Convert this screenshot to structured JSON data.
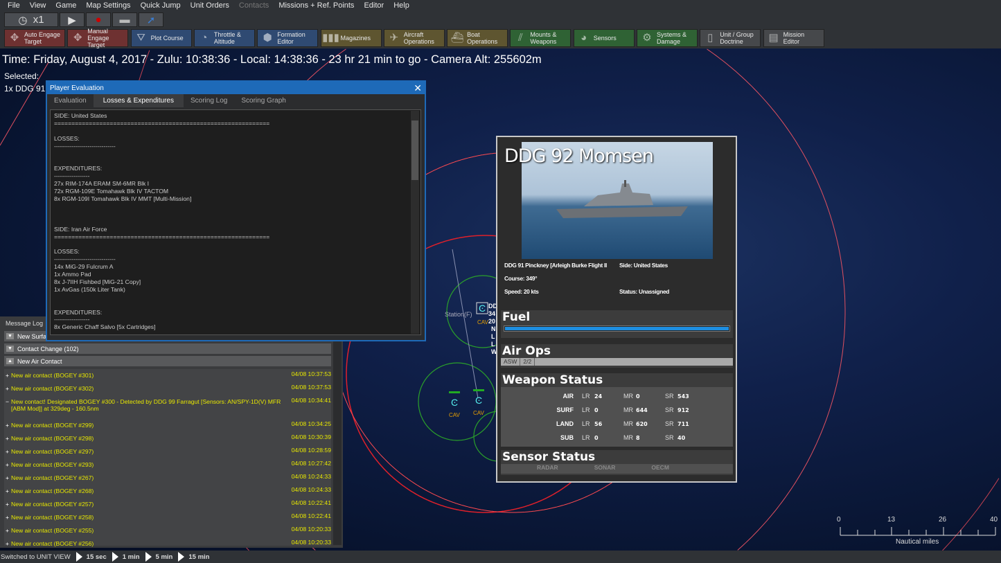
{
  "menu": [
    "File",
    "View",
    "Game",
    "Map Settings",
    "Quick Jump",
    "Unit Orders",
    "Contacts",
    "Missions + Ref. Points",
    "Editor",
    "Help"
  ],
  "menu_disabled": [
    "Contacts"
  ],
  "time_controls": {
    "speed": "x1",
    "icons": [
      "clock-icon",
      "play-icon",
      "record-icon",
      "layers-icon",
      "jump-arrow-icon"
    ]
  },
  "toolbar": [
    {
      "label1": "Auto Engage",
      "label2": "Target",
      "color": "red",
      "icon": "crosshair-icon"
    },
    {
      "label1": "Manual",
      "label2": "Engage Target",
      "color": "red",
      "icon": "crosshair-icon"
    },
    {
      "label1": "Plot Course",
      "label2": "",
      "color": "blue",
      "icon": "course-icon"
    },
    {
      "label1": "Throttle &",
      "label2": "Altitude",
      "color": "blue",
      "icon": "gauge-icon"
    },
    {
      "label1": "Formation",
      "label2": "Editor",
      "color": "blue",
      "icon": "formation-icon"
    },
    {
      "label1": "Magazines",
      "label2": "",
      "color": "olive",
      "icon": "ammo-icon"
    },
    {
      "label1": "Aircraft",
      "label2": "Operations",
      "color": "olive",
      "icon": "aircraft-icon"
    },
    {
      "label1": "Boat",
      "label2": "Operations",
      "color": "olive",
      "icon": "boat-icon"
    },
    {
      "label1": "Mounts &",
      "label2": "Weapons",
      "color": "green",
      "icon": "weapons-icon"
    },
    {
      "label1": "Sensors",
      "label2": "",
      "color": "green",
      "icon": "radar-icon"
    },
    {
      "label1": "Systems &",
      "label2": "Damage",
      "color": "green",
      "icon": "gear-icon"
    },
    {
      "label1": "Unit / Group",
      "label2": "Doctrine",
      "color": "gray",
      "icon": "document-icon"
    },
    {
      "label1": "Mission",
      "label2": "Editor",
      "color": "gray",
      "icon": "mission-icon"
    }
  ],
  "time_line": "Time: Friday, August 4, 2017 - Zulu: 10:38:36 - Local: 14:38:36 - 23 hr 21 min to go -  Camera Alt: 255602m",
  "selected": {
    "label": "Selected:",
    "unit": "1x DDG 91 Pinckney"
  },
  "eval_window": {
    "title": "Player Evaluation",
    "tabs": [
      "Evaluation",
      "Losses & Expenditures",
      "Scoring Log",
      "Scoring Graph"
    ],
    "active_tab": "Losses & Expenditures",
    "text": "SIDE: United States\n==============================================================\n\nLOSSES:\n-------------------------------\n\n\nEXPENDITURES:\n------------------\n27x RIM-174A ERAM SM-6MR Blk I\n72x RGM-109E Tomahawk Blk IV TACTOM\n8x RGM-109I Tomahawk Blk IV MMT [Multi-Mission]\n\n\n\nSIDE: Iran Air Force\n==============================================================\n\nLOSSES:\n-------------------------------\n14x MiG-29 Fulcrum A\n1x Ammo Pad\n8x J-7IIH Fishbed [MiG-21 Copy]\n1x AvGas (150k Liter Tank)\n\n\nEXPENDITURES:\n------------------\n8x Generic Chaff Salvo [5x Cartridges]"
  },
  "message_log": {
    "label": "Message Log",
    "groups": [
      "New Surface Contact",
      "Contact Change (102)",
      "New Air Contact"
    ],
    "entries": [
      {
        "text": "New air contact (BOGEY #301)",
        "time": "04/08 10:37:53",
        "expanded": false
      },
      {
        "text": "New air contact (BOGEY #302)",
        "time": "04/08 10:37:53",
        "expanded": false
      },
      {
        "text": "New contact! Designated BOGEY #300 - Detected by DDG 99 Farragut  [Sensors: AN/SPY-1D(V) MFR [ABM Mod]] at 329deg - 160.5nm",
        "time": "04/08 10:34:41",
        "expanded": true
      },
      {
        "text": "New air contact (BOGEY #299)",
        "time": "04/08 10:34:25",
        "expanded": false
      },
      {
        "text": "New air contact (BOGEY #298)",
        "time": "04/08 10:30:39",
        "expanded": false
      },
      {
        "text": "New air contact (BOGEY #297)",
        "time": "04/08 10:28:59",
        "expanded": false
      },
      {
        "text": "New air contact (BOGEY #293)",
        "time": "04/08 10:27:42",
        "expanded": false
      },
      {
        "text": "New air contact (BOGEY #267)",
        "time": "04/08 10:24:33",
        "expanded": false
      },
      {
        "text": "New air contact (BOGEY #268)",
        "time": "04/08 10:24:33",
        "expanded": false
      },
      {
        "text": "New air contact (BOGEY #257)",
        "time": "04/08 10:22:41",
        "expanded": false
      },
      {
        "text": "New air contact (BOGEY #258)",
        "time": "04/08 10:22:41",
        "expanded": false
      },
      {
        "text": "New air contact (BOGEY #255)",
        "time": "04/08 10:20:33",
        "expanded": false
      },
      {
        "text": "New air contact (BOGEY #256)",
        "time": "04/08 10:20:33",
        "expanded": false
      }
    ]
  },
  "map": {
    "station_label": "Station(F)",
    "unit_labels": [
      "CAV",
      "CAV",
      "CAV"
    ],
    "unit_callout": [
      "DD",
      "34",
      "20",
      "N",
      "L",
      "L",
      "W"
    ],
    "scale": {
      "ticks": [
        "0",
        "13",
        "26",
        "40"
      ],
      "unit": "Nautical miles"
    }
  },
  "unit_panel": {
    "name": "DDG 92 Momsen",
    "class": "DDG 91 Pinckney [Arleigh Burke Flight II",
    "side": "Side: United States",
    "course": "Course: 349°",
    "speed": "Speed: 20 kts",
    "status": "Status: Unassigned",
    "fuel_title": "Fuel",
    "fuel_fraction": 1.0,
    "airops_title": "Air Ops",
    "airops": [
      "ASW",
      "2/2"
    ],
    "weapon_title": "Weapon Status",
    "weapons": [
      {
        "cat": "AIR",
        "lr": "24",
        "mr": "0",
        "sr": "543"
      },
      {
        "cat": "SURF",
        "lr": "0",
        "mr": "644",
        "sr": "912"
      },
      {
        "cat": "LAND",
        "lr": "56",
        "mr": "620",
        "sr": "711"
      },
      {
        "cat": "SUB",
        "lr": "0",
        "mr": "8",
        "sr": "40"
      }
    ],
    "range_labels": {
      "lr": "LR",
      "mr": "MR",
      "sr": "SR"
    },
    "sensor_title": "Sensor Status",
    "sensors": [
      "RADAR",
      "SONAR",
      "OECM"
    ]
  },
  "status_bar": {
    "message": "Switched to UNIT VIEW",
    "steps": [
      "15 sec",
      "1 min",
      "5 min",
      "15 min"
    ]
  }
}
